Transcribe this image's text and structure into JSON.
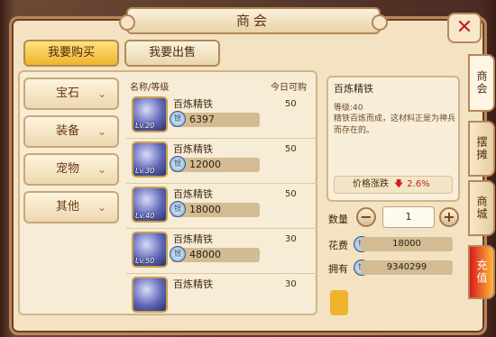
{
  "window": {
    "title": "商会"
  },
  "tabs": {
    "buy": "我要购买",
    "sell": "我要出售"
  },
  "categories": [
    {
      "label": "宝石"
    },
    {
      "label": "装备"
    },
    {
      "label": "宠物"
    },
    {
      "label": "其他"
    }
  ],
  "list_header": {
    "name": "名称/等级",
    "qty": "今日可购"
  },
  "items": [
    {
      "name": "百炼精铁",
      "level": "Lv.20",
      "price": "6397",
      "qty": "50"
    },
    {
      "name": "百炼精铁",
      "level": "Lv.30",
      "price": "12000",
      "qty": "50"
    },
    {
      "name": "百炼精铁",
      "level": "Lv.40",
      "price": "18000",
      "qty": "50"
    },
    {
      "name": "百炼精铁",
      "level": "Lv.50",
      "price": "48000",
      "qty": "30"
    },
    {
      "name": "百炼精铁",
      "level": "",
      "price": "",
      "qty": "30"
    }
  ],
  "detail": {
    "name": "百炼精铁",
    "level": "等级:40",
    "description": "精铁百炼而成，这材料正是为神兵而存在的。",
    "trend_label": "价格涨跌",
    "trend_value": "2.6%"
  },
  "purchase": {
    "qty_label": "数量",
    "qty_value": "1",
    "cost_label": "花费",
    "cost_value": "18000",
    "own_label": "拥有",
    "own_value": "9340299"
  },
  "side_tabs": [
    "商会",
    "摆摊",
    "商城",
    "充值"
  ],
  "colors": {
    "accent": "#f0b32e",
    "down": "#d11c1c",
    "panel": "#f3e3c3"
  },
  "icons": {
    "close": "close-icon",
    "chevron": "chevron-down-icon",
    "coin": "silver-coin-icon",
    "trend": "arrow-down-icon"
  }
}
